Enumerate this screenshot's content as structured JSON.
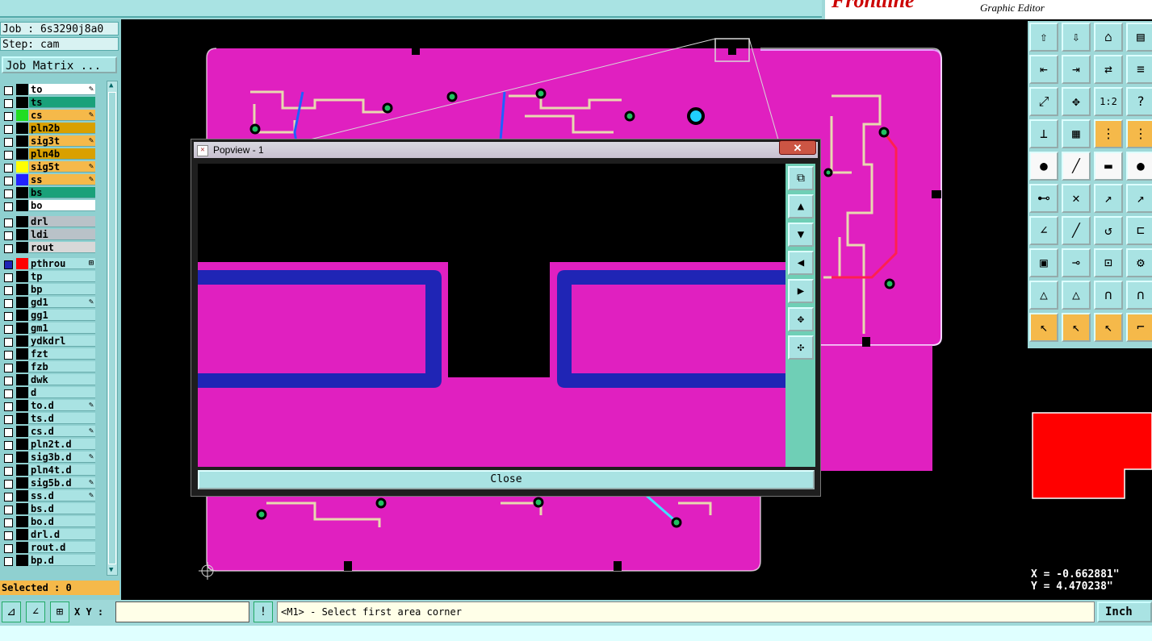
{
  "app": {
    "logo": "Frontline",
    "subtitle": "Graphic Editor"
  },
  "job": {
    "job_label": "Job : 6s3290j8a0",
    "step_label": "Step: cam",
    "matrix_button": "Job Matrix ..."
  },
  "layers_board": [
    {
      "name": "to",
      "color": "#ffffff",
      "swatch": "",
      "mark": "✎"
    },
    {
      "name": "ts",
      "color": "#1aa17a",
      "swatch": "",
      "mark": ""
    },
    {
      "name": "cs",
      "color": "#f5b94a",
      "swatch": "#22dd22",
      "mark": "✎"
    },
    {
      "name": "pln2b",
      "color": "#d9a000",
      "swatch": "",
      "mark": ""
    },
    {
      "name": "sig3t",
      "color": "#f5b94a",
      "swatch": "",
      "mark": "✎"
    },
    {
      "name": "pln4b",
      "color": "#d9a000",
      "swatch": "",
      "mark": ""
    },
    {
      "name": "sig5t",
      "color": "#f5b94a",
      "swatch": "#ffff00",
      "mark": "✎"
    },
    {
      "name": "ss",
      "color": "#f5b94a",
      "swatch": "#2222ff",
      "mark": "✎"
    },
    {
      "name": "bs",
      "color": "#1aa17a",
      "swatch": "",
      "mark": ""
    },
    {
      "name": "bo",
      "color": "#ffffff",
      "swatch": "",
      "mark": ""
    }
  ],
  "layers_drill": [
    {
      "name": "drl",
      "color": "#b9c2c8",
      "swatch": "",
      "mark": ""
    },
    {
      "name": "ldi",
      "color": "#b9c2c8",
      "swatch": "",
      "mark": ""
    },
    {
      "name": "rout",
      "color": "#d8d8d8",
      "swatch": "",
      "mark": ""
    }
  ],
  "layers_misc": [
    {
      "name": "pthrou",
      "color": "#a9e3e3",
      "swatch": "#ff0000",
      "mark": "⊞"
    },
    {
      "name": "tp",
      "color": "#a9e3e3",
      "swatch": "",
      "mark": ""
    },
    {
      "name": "bp",
      "color": "#a9e3e3",
      "swatch": "",
      "mark": ""
    },
    {
      "name": "gd1",
      "color": "#a9e3e3",
      "swatch": "",
      "mark": "✎"
    },
    {
      "name": "gg1",
      "color": "#a9e3e3",
      "swatch": "",
      "mark": ""
    },
    {
      "name": "gm1",
      "color": "#a9e3e3",
      "swatch": "",
      "mark": ""
    },
    {
      "name": "ydkdrl",
      "color": "#a9e3e3",
      "swatch": "",
      "mark": ""
    },
    {
      "name": "fzt",
      "color": "#a9e3e3",
      "swatch": "",
      "mark": ""
    },
    {
      "name": "fzb",
      "color": "#a9e3e3",
      "swatch": "",
      "mark": ""
    },
    {
      "name": "dwk",
      "color": "#a9e3e3",
      "swatch": "",
      "mark": ""
    },
    {
      "name": "d",
      "color": "#a9e3e3",
      "swatch": "",
      "mark": ""
    },
    {
      "name": "to.d",
      "color": "#a9e3e3",
      "swatch": "",
      "mark": "✎"
    },
    {
      "name": "ts.d",
      "color": "#a9e3e3",
      "swatch": "",
      "mark": ""
    },
    {
      "name": "cs.d",
      "color": "#a9e3e3",
      "swatch": "",
      "mark": "✎"
    },
    {
      "name": "pln2t.d",
      "color": "#a9e3e3",
      "swatch": "",
      "mark": ""
    },
    {
      "name": "sig3b.d",
      "color": "#a9e3e3",
      "swatch": "",
      "mark": "✎"
    },
    {
      "name": "pln4t.d",
      "color": "#a9e3e3",
      "swatch": "",
      "mark": ""
    },
    {
      "name": "sig5b.d",
      "color": "#a9e3e3",
      "swatch": "",
      "mark": "✎"
    },
    {
      "name": "ss.d",
      "color": "#a9e3e3",
      "swatch": "",
      "mark": "✎"
    },
    {
      "name": "bs.d",
      "color": "#a9e3e3",
      "swatch": "",
      "mark": ""
    },
    {
      "name": "bo.d",
      "color": "#a9e3e3",
      "swatch": "",
      "mark": ""
    },
    {
      "name": "drl.d",
      "color": "#a9e3e3",
      "swatch": "",
      "mark": ""
    },
    {
      "name": "rout.d",
      "color": "#a9e3e3",
      "swatch": "",
      "mark": ""
    },
    {
      "name": "bp.d",
      "color": "#a9e3e3",
      "swatch": "",
      "mark": ""
    }
  ],
  "status": {
    "selected": "Selected : 0",
    "xy_label": "X Y :",
    "xy_value": "",
    "message": "<M1> - Select first area corner",
    "units": "Inch"
  },
  "coords": {
    "x": "X = -0.662881\"",
    "y": "Y = 4.470238\""
  },
  "popview": {
    "title": "Popview - 1",
    "close_x": "✕",
    "close_button": "Close"
  },
  "toolbar": {
    "zoom_ratio": "1:2",
    "help": "?"
  },
  "colors": {
    "board": "#e020c0",
    "copper_outline": "#1f25b5",
    "trace": "#e8d8b0",
    "panel": "#9ed8d8"
  }
}
